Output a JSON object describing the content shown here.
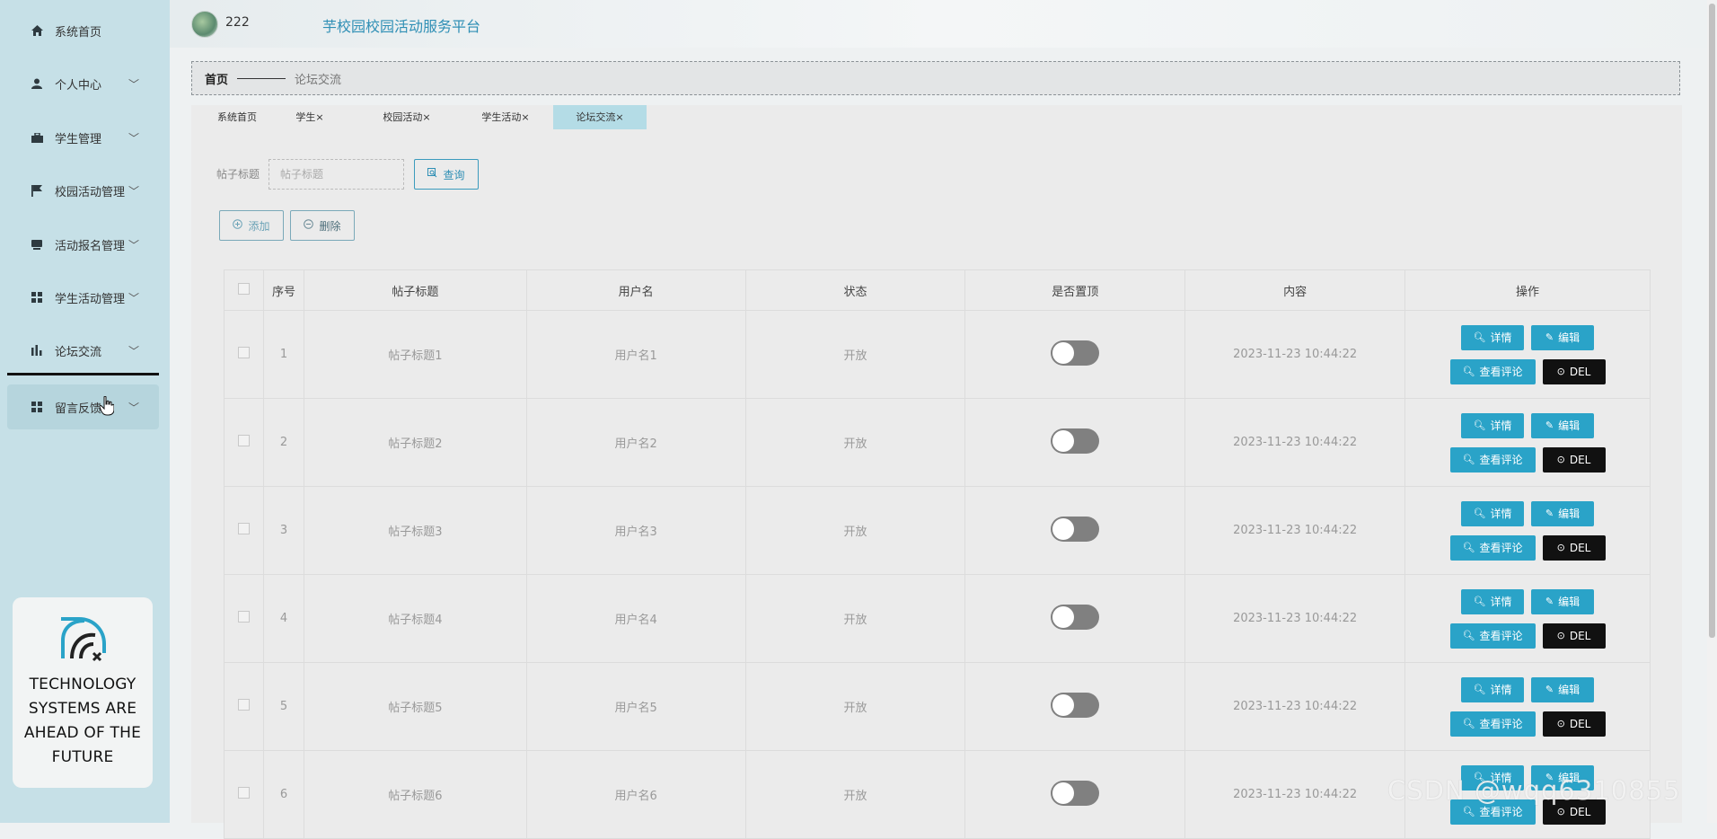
{
  "sidebar": {
    "items": [
      {
        "label": "系统首页",
        "icon": "home-icon",
        "has_chevron": false
      },
      {
        "label": "个人中心",
        "icon": "user-icon",
        "has_chevron": true
      },
      {
        "label": "学生管理",
        "icon": "briefcase-icon",
        "has_chevron": true
      },
      {
        "label": "校园活动管理",
        "icon": "flag-icon",
        "has_chevron": true
      },
      {
        "label": "活动报名管理",
        "icon": "inbox-icon",
        "has_chevron": true
      },
      {
        "label": "学生活动管理",
        "icon": "grid-icon",
        "has_chevron": true
      },
      {
        "label": "论坛交流",
        "icon": "bar-chart-icon",
        "has_chevron": true
      },
      {
        "label": "留言反馈",
        "icon": "grid-icon",
        "has_chevron": true
      }
    ],
    "promo": {
      "line1": "TECHNOLOGY",
      "line2": "SYSTEMS ARE",
      "line3": "AHEAD OF THE",
      "line4": "FUTURE"
    }
  },
  "header": {
    "username": "222",
    "title": "芋校园校园活动服务平台"
  },
  "breadcrumb": {
    "home": "首页",
    "current": "论坛交流"
  },
  "tabs": [
    {
      "label": "系统首页"
    },
    {
      "label": "学生×"
    },
    {
      "label": "校园活动×"
    },
    {
      "label": "学生活动×"
    },
    {
      "label": "论坛交流×"
    }
  ],
  "search": {
    "label": "帖子标题",
    "placeholder": "帖子标题",
    "button": "查询"
  },
  "actions": {
    "add": "添加",
    "delete": "删除"
  },
  "table": {
    "columns": [
      "序号",
      "帖子标题",
      "用户名",
      "状态",
      "是否置顶",
      "内容",
      "操作"
    ],
    "buttons": {
      "detail": "详情",
      "edit": "编辑",
      "comments": "查看评论",
      "del": "DEL"
    },
    "rows": [
      {
        "no": "1",
        "title": "帖子标题1",
        "user": "用户名1",
        "status": "开放",
        "pinned": false,
        "content": "2023-11-23 10:44:22"
      },
      {
        "no": "2",
        "title": "帖子标题2",
        "user": "用户名2",
        "status": "开放",
        "pinned": false,
        "content": "2023-11-23 10:44:22"
      },
      {
        "no": "3",
        "title": "帖子标题3",
        "user": "用户名3",
        "status": "开放",
        "pinned": false,
        "content": "2023-11-23 10:44:22"
      },
      {
        "no": "4",
        "title": "帖子标题4",
        "user": "用户名4",
        "status": "开放",
        "pinned": false,
        "content": "2023-11-23 10:44:22"
      },
      {
        "no": "5",
        "title": "帖子标题5",
        "user": "用户名5",
        "status": "开放",
        "pinned": false,
        "content": "2023-11-23 10:44:22"
      },
      {
        "no": "6",
        "title": "帖子标题6",
        "user": "用户名6",
        "status": "开放",
        "pinned": false,
        "content": "2023-11-23 10:44:22"
      }
    ]
  },
  "watermark": "CSDN @wqq6310855",
  "colors": {
    "sidebar_bg": "#c6e0e7",
    "accent": "#2aa3c8",
    "title": "#2f8fb5",
    "dark_button": "#111111",
    "active_tab": "#b4dce6"
  }
}
